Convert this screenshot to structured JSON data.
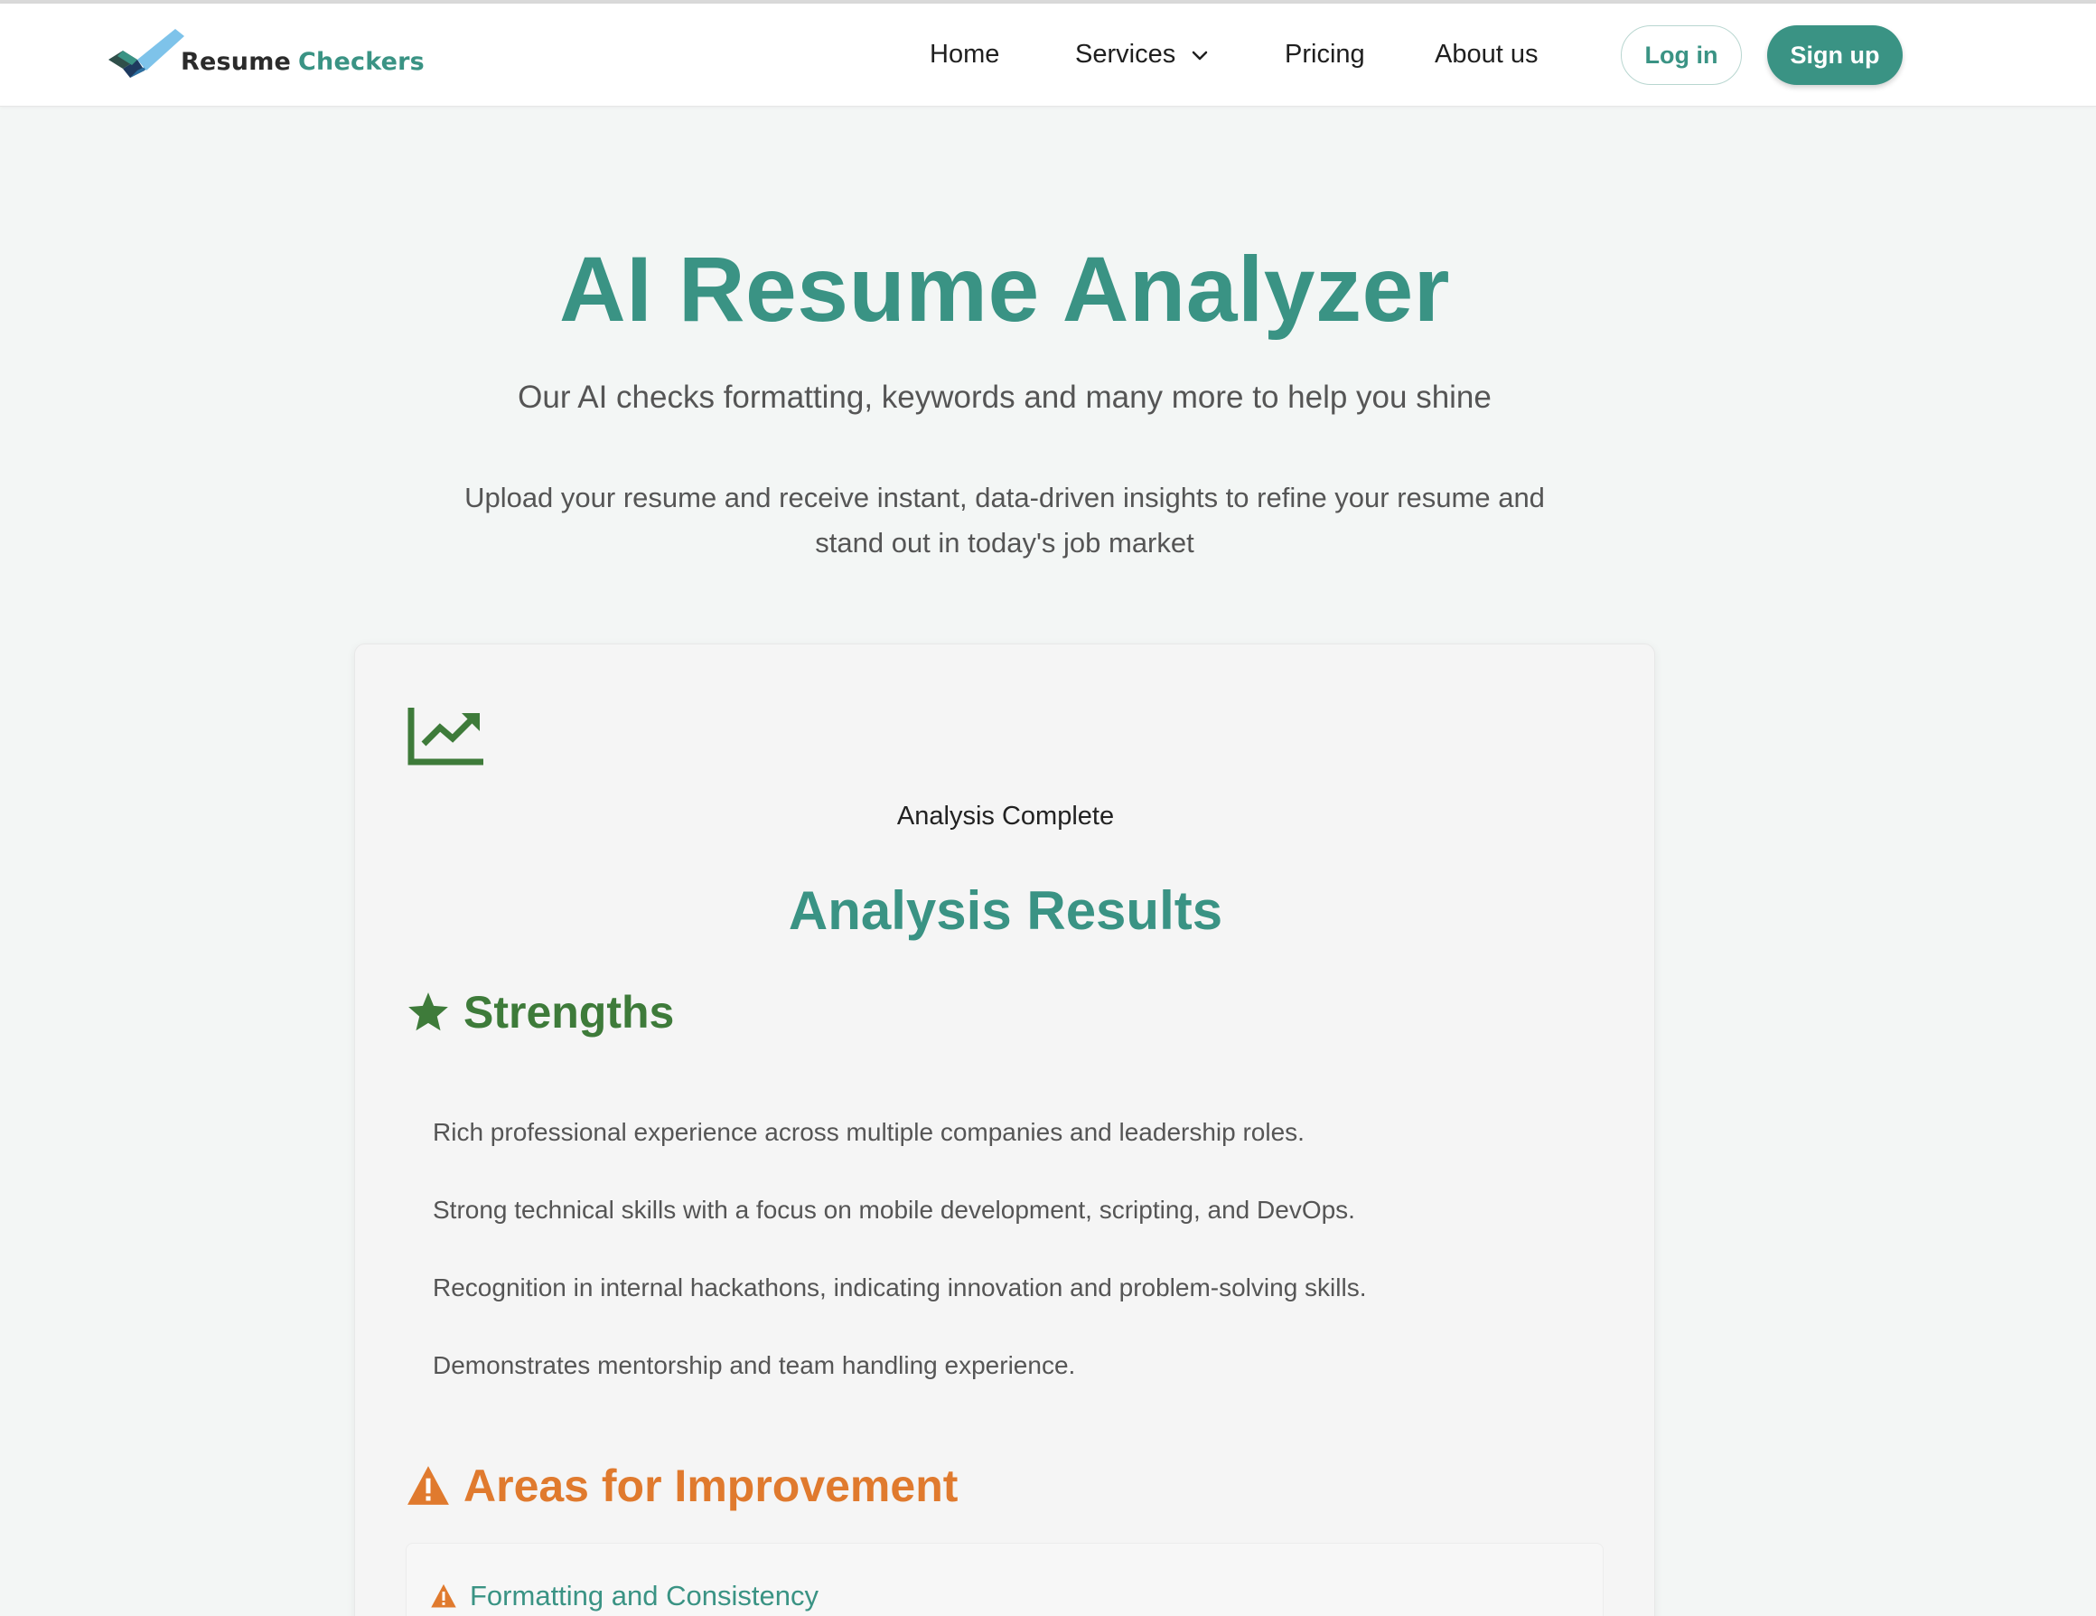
{
  "header": {
    "logo": {
      "word1": "Resume",
      "word2": "Checkers"
    },
    "nav": {
      "home": "Home",
      "services": "Services",
      "pricing": "Pricing",
      "about": "About us"
    },
    "login_label": "Log in",
    "signup_label": "Sign up"
  },
  "hero": {
    "title": "AI Resume Analyzer",
    "subtitle": "Our AI checks formatting, keywords and many more to help you shine",
    "description": "Upload your resume and receive instant, data-driven insights to refine your resume and stand out in today's job market"
  },
  "results": {
    "status": "Analysis Complete",
    "title": "Analysis Results",
    "strengths": {
      "heading": "Strengths",
      "items": [
        "Rich professional experience across multiple companies and leadership roles.",
        "Strong technical skills with a focus on mobile development, scripting, and DevOps.",
        "Recognition in internal hackathons, indicating innovation and problem-solving skills.",
        "Demonstrates mentorship and team handling experience."
      ]
    },
    "improvements": {
      "heading": "Areas for Improvement",
      "items": [
        {
          "title": "Formatting and Consistency"
        }
      ]
    }
  },
  "colors": {
    "brand": "#3a9384",
    "strength": "#3e7b3a",
    "warning": "#e07a2e",
    "background": "#f3f6f5"
  },
  "icons": {
    "logo": "checkmark-logo-icon",
    "services_dropdown": "chevron-down-icon",
    "analysis": "chart-trend-up-icon",
    "strengths": "star-icon",
    "improvements": "warning-triangle-icon"
  }
}
